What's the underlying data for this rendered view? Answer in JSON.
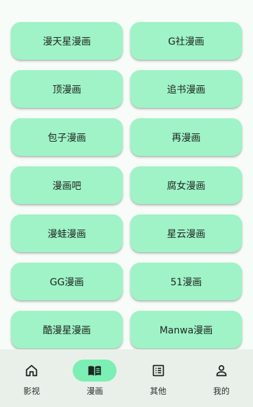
{
  "sources": [
    "漫天星漫画",
    "G社漫画",
    "顶漫画",
    "追书漫画",
    "包子漫画",
    "再漫画",
    "漫画吧",
    "腐女漫画",
    "漫蛙漫画",
    "星云漫画",
    "GG漫画",
    "51漫画",
    "酷漫星漫画",
    "Manwa漫画"
  ],
  "nav": {
    "items": [
      {
        "label": "影视",
        "icon": "home-icon",
        "active": false
      },
      {
        "label": "漫画",
        "icon": "book-icon",
        "active": true
      },
      {
        "label": "其他",
        "icon": "list-icon",
        "active": false
      },
      {
        "label": "我的",
        "icon": "person-icon",
        "active": false
      }
    ]
  },
  "colors": {
    "tile": "#9ff3c6",
    "nav_active": "#7cefb4",
    "nav_bg": "#e9f0ea"
  }
}
